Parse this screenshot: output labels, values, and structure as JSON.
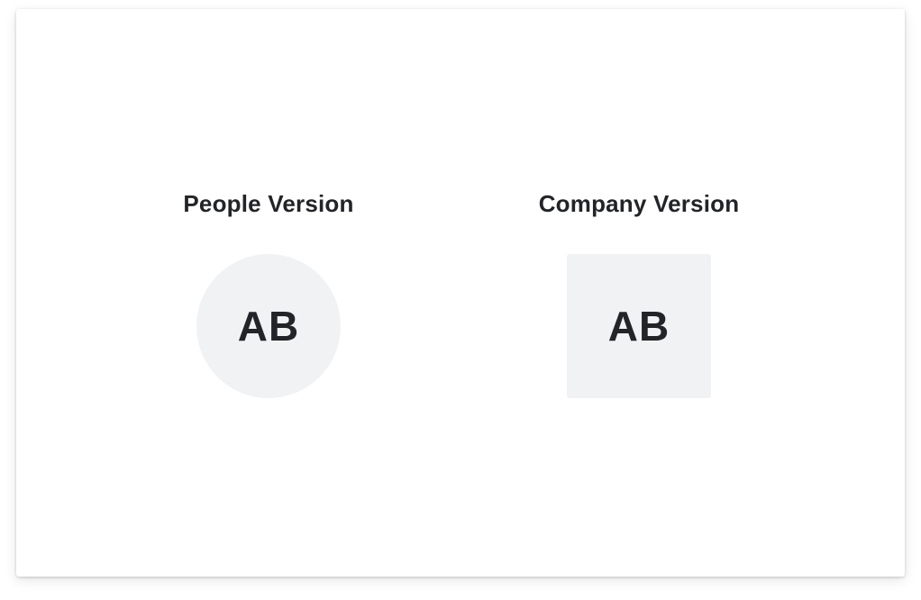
{
  "people": {
    "title": "People Version",
    "initials": "AB"
  },
  "company": {
    "title": "Company Version",
    "initials": "AB"
  },
  "colors": {
    "avatar_bg": "#f1f2f4",
    "text": "#222428"
  }
}
